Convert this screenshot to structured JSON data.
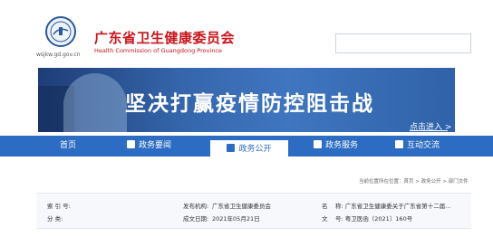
{
  "header": {
    "site_url": "wsjkw.gd.gov.cn",
    "org_name_cn": "广东省卫生健康委员会",
    "org_name_en": "Health Commission of Guangdong Province",
    "search_placeholder": ""
  },
  "banner": {
    "headline": "坚决打赢疫情防控阻击战",
    "more_label": "点击进入 >"
  },
  "nav": {
    "items": [
      {
        "label": "首页",
        "icon": "none"
      },
      {
        "label": "政务要闻",
        "icon": "news-icon"
      },
      {
        "label": "政务公开",
        "icon": "open-icon"
      },
      {
        "label": "政务服务",
        "icon": "service-icon"
      },
      {
        "label": "互动交流",
        "icon": "chat-icon"
      }
    ],
    "active": "政务公开"
  },
  "breadcrumb": "当前位置所在位置：首页 > 政务公开 > 部门文件",
  "meta": {
    "index_label": "索 引 号:",
    "index_value": "",
    "category_label": "分 类:",
    "category_value": "",
    "publisher_label": "发布机构:",
    "publisher_value": "广东省卫生健康委员会",
    "date_label": "成文日期:",
    "date_value": "2021年05月21日",
    "title_label": "名",
    "title_value": "称: 广东省卫生健康委关于广东省第十二届...",
    "doc_no_label": "文",
    "doc_no_value": "号: 粤卫医函〔2021〕160号"
  },
  "colors": {
    "brand_red": "#c8161d",
    "nav_blue": "#2c6cc2"
  }
}
